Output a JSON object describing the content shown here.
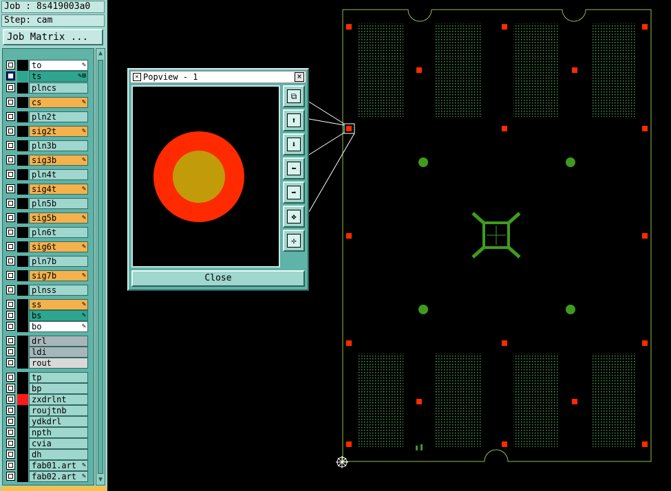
{
  "job_info": {
    "job": "Job : 8s419003a0",
    "step": "Step: cam"
  },
  "job_matrix_label": "Job Matrix ...",
  "layers": [
    {
      "name": "to",
      "bg": "#ffffff",
      "color": "#000000",
      "mark": "✎",
      "selected": false
    },
    {
      "name": "ts",
      "bg": "#2ea68f",
      "color": "#2ea68f",
      "mark": "✎⊞",
      "selected": true
    },
    {
      "name": "plncs",
      "bg": "#9fd6cd",
      "color": "#000000",
      "mark": "",
      "selected": false
    },
    {
      "name": "cs",
      "bg": "#f5b14c",
      "color": "#000000",
      "mark": "✎",
      "selected": false
    },
    {
      "name": "pln2t",
      "bg": "#9fd6cd",
      "color": "#000000",
      "mark": "",
      "selected": false
    },
    {
      "name": "sig2t",
      "bg": "#f5b14c",
      "color": "#000000",
      "mark": "✎",
      "selected": false
    },
    {
      "name": "pln3b",
      "bg": "#9fd6cd",
      "color": "#000000",
      "mark": "",
      "selected": false
    },
    {
      "name": "sig3b",
      "bg": "#f5b14c",
      "color": "#000000",
      "mark": "✎",
      "selected": false
    },
    {
      "name": "pln4t",
      "bg": "#9fd6cd",
      "color": "#000000",
      "mark": "",
      "selected": false
    },
    {
      "name": "sig4t",
      "bg": "#f5b14c",
      "color": "#000000",
      "mark": "✎",
      "selected": false
    },
    {
      "name": "pln5b",
      "bg": "#9fd6cd",
      "color": "#000000",
      "mark": "",
      "selected": false
    },
    {
      "name": "sig5b",
      "bg": "#f5b14c",
      "color": "#000000",
      "mark": "✎",
      "selected": false
    },
    {
      "name": "pln6t",
      "bg": "#9fd6cd",
      "color": "#000000",
      "mark": "",
      "selected": false
    },
    {
      "name": "sig6t",
      "bg": "#f5b14c",
      "color": "#000000",
      "mark": "✎",
      "selected": false
    },
    {
      "name": "pln7b",
      "bg": "#9fd6cd",
      "color": "#000000",
      "mark": "",
      "selected": false
    },
    {
      "name": "sig7b",
      "bg": "#f5b14c",
      "color": "#000000",
      "mark": "✎",
      "selected": false
    },
    {
      "name": "plnss",
      "bg": "#9fd6cd",
      "color": "#000000",
      "mark": "",
      "selected": false
    },
    {
      "name": "ss",
      "bg": "#f5b14c",
      "color": "#000000",
      "mark": "✎",
      "selected": false
    },
    {
      "name": "bs",
      "bg": "#2ea68f",
      "color": "#000000",
      "mark": "✎",
      "selected": false
    },
    {
      "name": "bo",
      "bg": "#ffffff",
      "color": "#000000",
      "mark": "✎",
      "selected": false
    },
    {
      "name": "drl",
      "bg": "#a7b6bb",
      "color": "#000000",
      "mark": "",
      "selected": false
    },
    {
      "name": "ldi",
      "bg": "#a7b6bb",
      "color": "#000000",
      "mark": "",
      "selected": false
    },
    {
      "name": "rout",
      "bg": "#d9d9d9",
      "color": "#000000",
      "mark": "",
      "selected": false
    },
    {
      "name": "tp",
      "bg": "#9fd6cd",
      "color": "#000000",
      "mark": "",
      "selected": false
    },
    {
      "name": "bp",
      "bg": "#9fd6cd",
      "color": "#000000",
      "mark": "",
      "selected": false
    },
    {
      "name": "zxdrlnt",
      "bg": "#9fd6cd",
      "color": "#ff1a1a",
      "mark": "",
      "selected": false
    },
    {
      "name": "roujtnb",
      "bg": "#9fd6cd",
      "color": "#000000",
      "mark": "",
      "selected": false
    },
    {
      "name": "ydkdrl",
      "bg": "#9fd6cd",
      "color": "#000000",
      "mark": "",
      "selected": false
    },
    {
      "name": "npth",
      "bg": "#9fd6cd",
      "color": "#000000",
      "mark": "",
      "selected": false
    },
    {
      "name": "cvia",
      "bg": "#9fd6cd",
      "color": "#000000",
      "mark": "",
      "selected": false
    },
    {
      "name": "dh",
      "bg": "#9fd6cd",
      "color": "#000000",
      "mark": "",
      "selected": false
    },
    {
      "name": "fab01.art",
      "bg": "#9fd6cd",
      "color": "#000000",
      "mark": "✎",
      "selected": false
    },
    {
      "name": "fab02.art",
      "bg": "#9fd6cd",
      "color": "#000000",
      "mark": "✎",
      "selected": false
    }
  ],
  "popview": {
    "title": "Popview - 1",
    "close_label": "Close"
  },
  "popview_tools": [
    "zoom-fit-icon",
    "pan-up-icon",
    "pan-down-icon",
    "pan-left-icon",
    "pan-right-icon",
    "zoom-in-icon",
    "zoom-out-icon"
  ],
  "colors": {
    "board_outline": "#8bc34a",
    "pad_red": "#ff2a00",
    "pad_gold": "#c29b0a",
    "dot_green": "#4caf50",
    "feature_green": "#3f9b1e",
    "panel_bg": "#9fd6cd"
  }
}
